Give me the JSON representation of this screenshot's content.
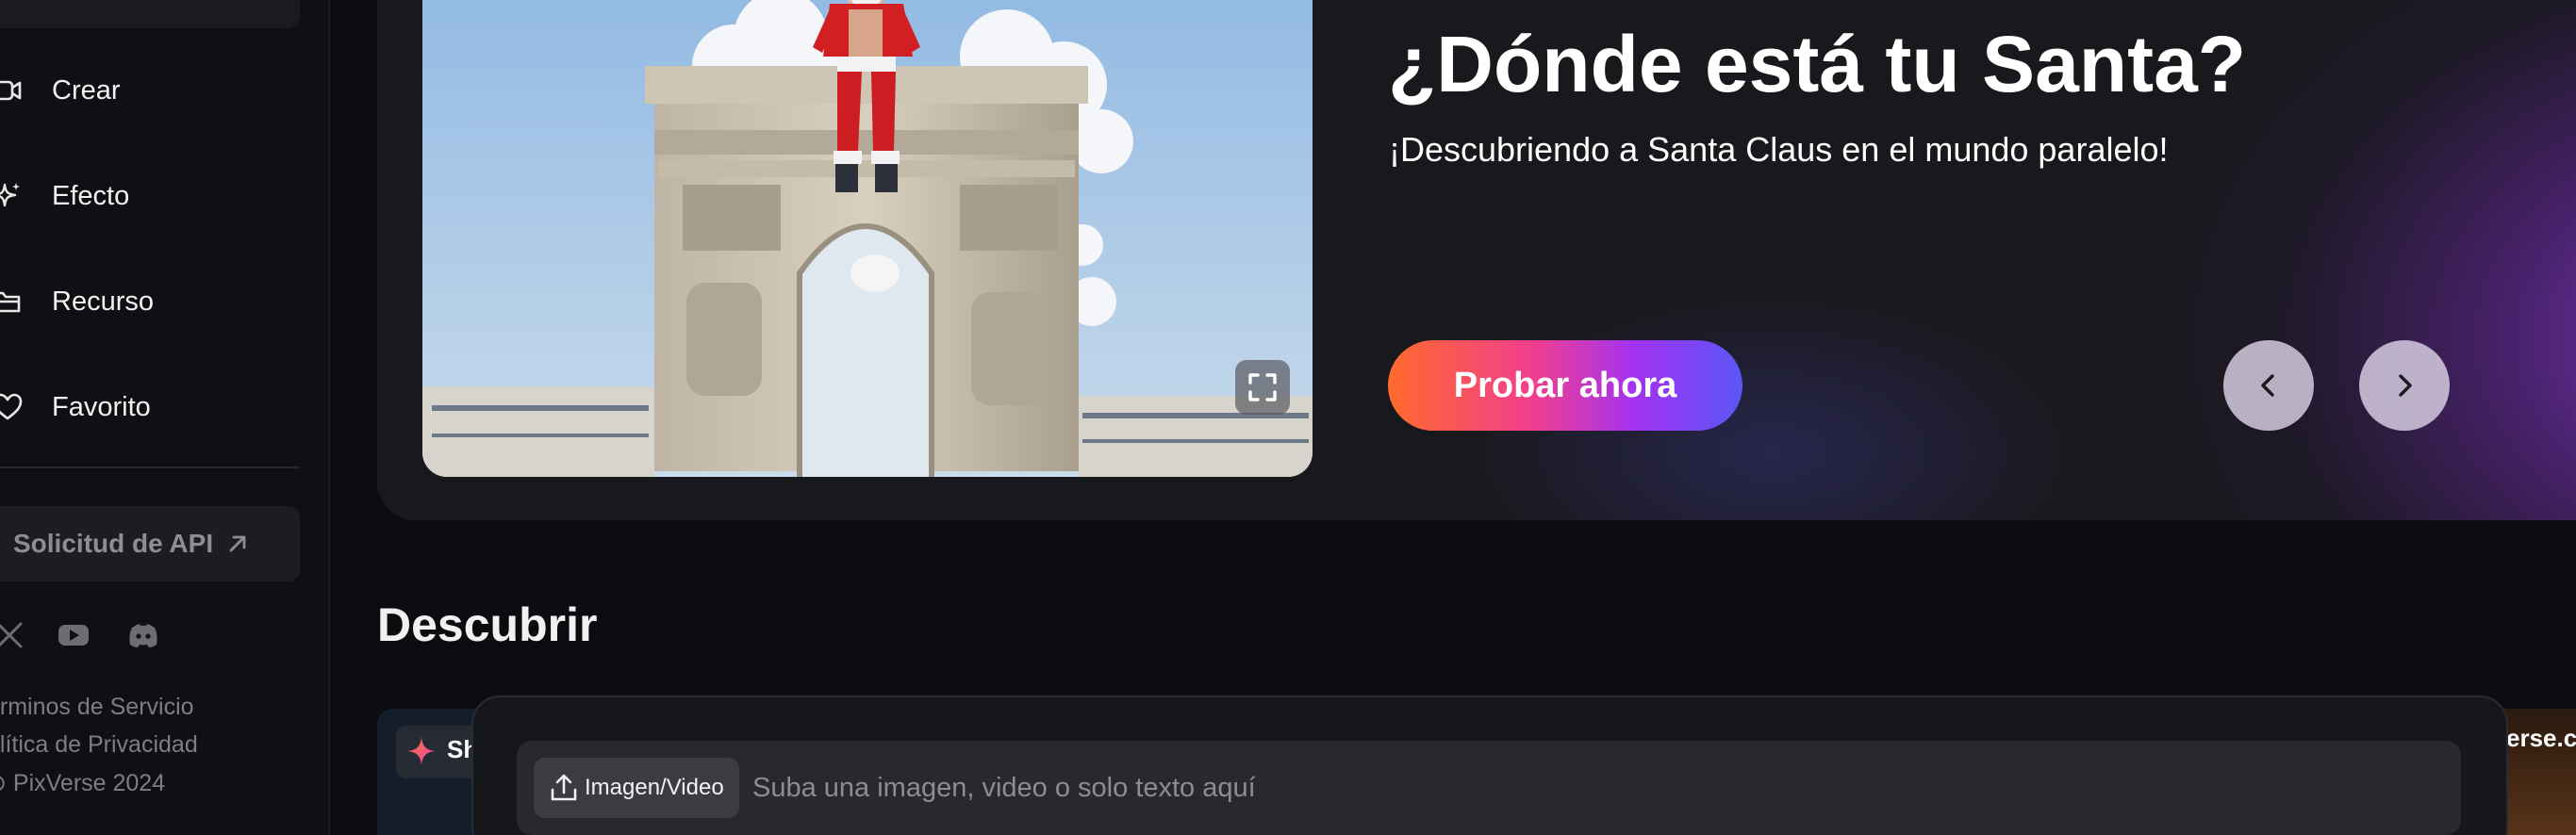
{
  "sidebar": {
    "nav": [
      {
        "label": "Crear",
        "icon": "video-camera-icon"
      },
      {
        "label": "Efecto",
        "icon": "sparkle-icon"
      },
      {
        "label": "Recurso",
        "icon": "folder-icon"
      },
      {
        "label": "Favorito",
        "icon": "heart-icon"
      }
    ],
    "api_button": {
      "label": "Solicitud de API",
      "icon": "arrow-up-right-icon"
    },
    "social": [
      "x-icon",
      "youtube-icon",
      "discord-icon"
    ],
    "footer": {
      "terms": "érminos de Servicio",
      "privacy": "olítica de Privacidad",
      "copyright": "⊙ PixVerse 2024"
    }
  },
  "hero": {
    "title": "¿Dónde está tu Santa?",
    "subtitle": "¡Descubriendo a Santa Claus en el mundo paralelo!",
    "cta_label": "Probar ahora",
    "prev_icon": "chevron-left-icon",
    "next_icon": "chevron-right-icon",
    "fullscreen_icon": "fullscreen-icon"
  },
  "discover": {
    "title": "Descubrir",
    "left_card_text": "Sh",
    "right_card_text": "erse.c"
  },
  "composer": {
    "upload_label": "Imagen/Video",
    "placeholder": "Suba una imagen, video o solo texto aquí"
  },
  "colors": {
    "cta_gradient": [
      "#ff6a2c",
      "#f23f8c",
      "#a232f2",
      "#5b57f5"
    ],
    "accent_purple": "#8c3cd2",
    "background": "#0b0c0f"
  }
}
